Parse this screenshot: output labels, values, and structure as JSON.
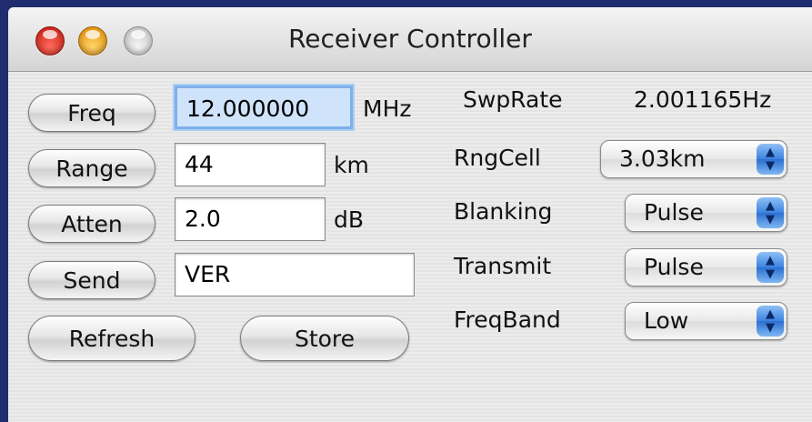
{
  "window": {
    "title": "Receiver Controller",
    "traffic_lights": [
      "close",
      "minimize",
      "zoom"
    ]
  },
  "left": {
    "rows": [
      {
        "button": "Freq",
        "value": "12.000000",
        "unit": "MHz"
      },
      {
        "button": "Range",
        "value": "44",
        "unit": "km"
      },
      {
        "button": "Atten",
        "value": "2.0",
        "unit": "dB"
      },
      {
        "button": "Send",
        "value": "VER",
        "unit": ""
      }
    ],
    "refresh_label": "Refresh",
    "store_label": "Store"
  },
  "right": {
    "swprate": {
      "label": "SwpRate",
      "value": "2.001165Hz"
    },
    "rngcell": {
      "label": "RngCell",
      "selected": "3.03km"
    },
    "blanking": {
      "label": "Blanking",
      "selected": "Pulse"
    },
    "transmit": {
      "label": "Transmit",
      "selected": "Pulse"
    },
    "freqband": {
      "label": "FreqBand",
      "selected": "Low"
    }
  },
  "colors": {
    "desktop": "#1f2d6e",
    "focus_field": "#cfe3fb",
    "popup_arrow": "#3c82e0"
  },
  "icons": {
    "popup_arrows": "up-down-arrows-icon"
  }
}
